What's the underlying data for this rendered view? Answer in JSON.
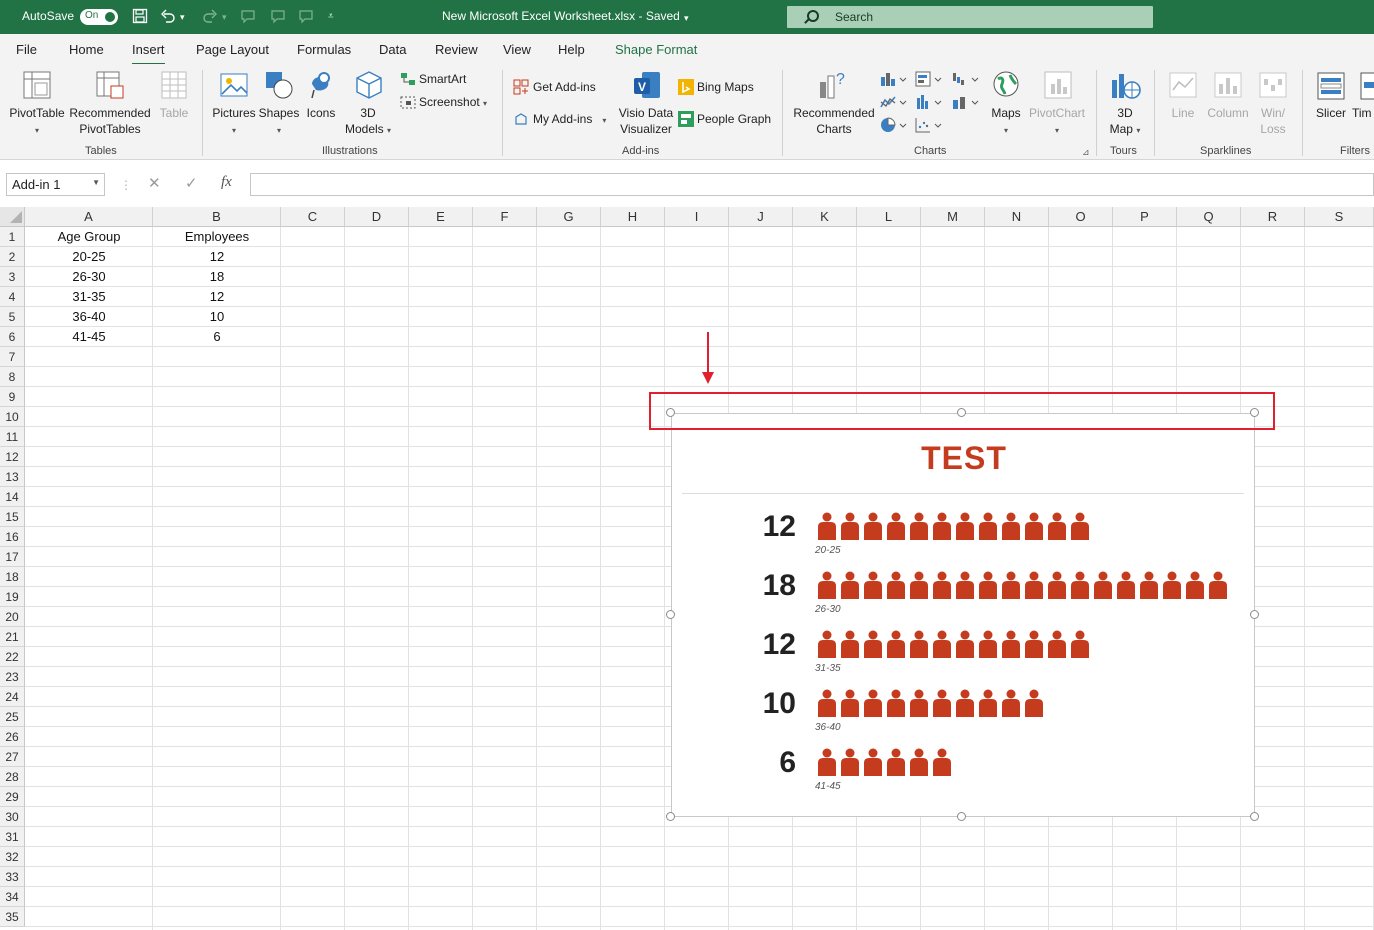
{
  "titlebar": {
    "autosave_label": "AutoSave",
    "autosave_state": "On",
    "doc_title": "New Microsoft Excel Worksheet.xlsx  -  Saved",
    "search_placeholder": "Search"
  },
  "menu": {
    "tabs": [
      "File",
      "Home",
      "Insert",
      "Page Layout",
      "Formulas",
      "Data",
      "Review",
      "View",
      "Help",
      "Shape Format"
    ],
    "active": "Insert"
  },
  "ribbon": {
    "tables": {
      "pivot_table": "PivotTable",
      "recommended_pivot_1": "Recommended",
      "recommended_pivot_2": "PivotTables",
      "table": "Table",
      "label": "Tables"
    },
    "illustrations": {
      "pictures": "Pictures",
      "shapes": "Shapes",
      "icons": "Icons",
      "models_1": "3D",
      "models_2": "Models",
      "smartart": "SmartArt",
      "screenshot": "Screenshot",
      "label": "Illustrations"
    },
    "addins": {
      "get": "Get Add-ins",
      "my": "My Add-ins",
      "visio_1": "Visio Data",
      "visio_2": "Visualizer",
      "bing": "Bing Maps",
      "people": "People Graph",
      "label": "Add-ins"
    },
    "charts": {
      "recommended_1": "Recommended",
      "recommended_2": "Charts",
      "maps": "Maps",
      "pivot_chart": "PivotChart",
      "label": "Charts"
    },
    "tours": {
      "map_1": "3D",
      "map_2": "Map",
      "label": "Tours"
    },
    "sparklines": {
      "line": "Line",
      "column": "Column",
      "winloss_1": "Win/",
      "winloss_2": "Loss",
      "label": "Sparklines"
    },
    "filters": {
      "slicer": "Slicer",
      "timeline": "Tim",
      "label": "Filters"
    }
  },
  "formula_bar": {
    "name_box": "Add-in 1",
    "fx": "fx",
    "content": ""
  },
  "columns": [
    "A",
    "B",
    "C",
    "D",
    "E",
    "F",
    "G",
    "H",
    "I",
    "J",
    "K",
    "L",
    "M",
    "N",
    "O",
    "P",
    "Q",
    "R",
    "S"
  ],
  "rows": [
    "1",
    "2",
    "3",
    "4",
    "5",
    "6",
    "7",
    "8",
    "9",
    "10",
    "11",
    "12",
    "13",
    "14",
    "15",
    "16",
    "17",
    "18",
    "19",
    "20",
    "21",
    "22",
    "23",
    "24",
    "25",
    "26",
    "27",
    "28",
    "29",
    "30",
    "31",
    "32",
    "33",
    "34",
    "35"
  ],
  "sheet": {
    "headers": [
      "Age Group",
      "Employees"
    ],
    "data": [
      [
        "20-25",
        "12"
      ],
      [
        "26-30",
        "18"
      ],
      [
        "31-35",
        "12"
      ],
      [
        "36-40",
        "10"
      ],
      [
        "41-45",
        "6"
      ]
    ]
  },
  "colors": {
    "brand_green": "#217346",
    "chart_accent": "#c43b1d",
    "highlight_red": "#e0202d"
  },
  "chart_data": {
    "type": "bar",
    "title": "TEST",
    "categories": [
      "20-25",
      "26-30",
      "31-35",
      "36-40",
      "41-45"
    ],
    "values": [
      12,
      18,
      12,
      10,
      6
    ],
    "icon": "person-icon",
    "color": "#c43b1d"
  }
}
